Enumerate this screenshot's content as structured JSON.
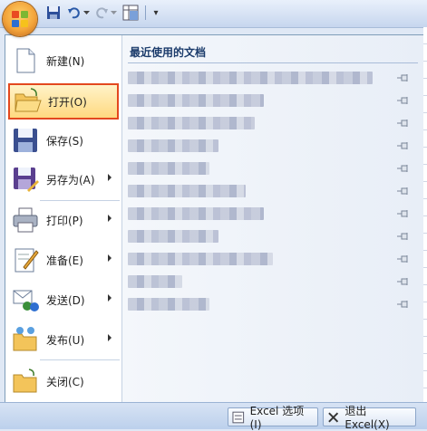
{
  "toolbar": {
    "more_label": "▾"
  },
  "menu": {
    "items": [
      {
        "label": "新建(N)",
        "icon": "new-document-icon",
        "submenu": false
      },
      {
        "label": "打开(O)",
        "icon": "open-folder-icon",
        "submenu": false,
        "active": true
      },
      {
        "label": "保存(S)",
        "icon": "save-disk-icon",
        "submenu": false
      },
      {
        "label": "另存为(A)",
        "icon": "save-as-icon",
        "submenu": true
      },
      {
        "label": "打印(P)",
        "icon": "printer-icon",
        "submenu": true
      },
      {
        "label": "准备(E)",
        "icon": "prepare-icon",
        "submenu": true
      },
      {
        "label": "发送(D)",
        "icon": "send-icon",
        "submenu": true
      },
      {
        "label": "发布(U)",
        "icon": "publish-icon",
        "submenu": true
      },
      {
        "label": "关闭(C)",
        "icon": "close-folder-icon",
        "submenu": false
      }
    ]
  },
  "recent": {
    "title": "最近使用的文档",
    "rows": 11
  },
  "footer": {
    "options_label": "Excel 选项(I)",
    "exit_label": "退出 Excel(X)"
  },
  "colors": {
    "active_border": "#e3481f",
    "active_fill": "#ffd980",
    "panel_border": "#7f9db9"
  }
}
